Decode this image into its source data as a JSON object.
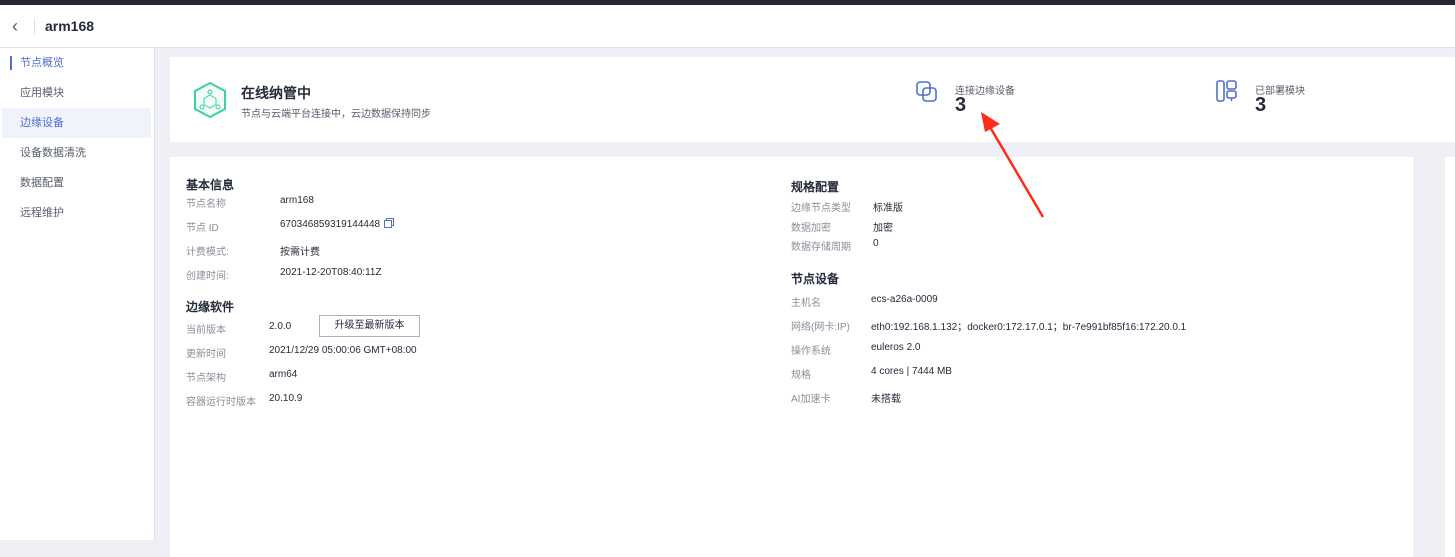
{
  "header": {
    "title": "arm168",
    "back_icon": "chevron-left-icon"
  },
  "sidebar": {
    "items": [
      {
        "label": "节点概览",
        "selected": true
      },
      {
        "label": "应用模块"
      },
      {
        "label": "边缘设备",
        "highlighted": true
      },
      {
        "label": "设备数据清洗"
      },
      {
        "label": "数据配置"
      },
      {
        "label": "远程维护"
      }
    ]
  },
  "status": {
    "title": "在线纳管中",
    "subtitle": "节点与云端平台连接中，云边数据保持同步",
    "stats": [
      {
        "label": "连接边缘设备",
        "value": "3",
        "icon": "linked-squares-icon"
      },
      {
        "label": "已部署模块",
        "value": "3",
        "icon": "module-layout-icon"
      }
    ]
  },
  "basic": {
    "title": "基本信息",
    "rows": [
      {
        "k": "节点名称",
        "v": "arm168"
      },
      {
        "k": "节点 ID",
        "v": "670346859319144448"
      },
      {
        "k": "计费模式:",
        "v": "按需计费"
      },
      {
        "k": "创建时间:",
        "v": "2021-12-20T08:40:11Z"
      }
    ]
  },
  "software": {
    "title": "边缘软件",
    "rows": [
      {
        "k": "当前版本",
        "v": "2.0.0"
      },
      {
        "k": "更新时间",
        "v": "2021/12/29 05:00:06 GMT+08:00"
      },
      {
        "k": "节点架构",
        "v": "arm64"
      },
      {
        "k": "容器运行时版本",
        "v": "20.10.9"
      }
    ],
    "upgrade_label": "升级至最新版本"
  },
  "spec": {
    "title": "规格配置",
    "rows": [
      {
        "k": "边缘节点类型",
        "v": "标准版"
      },
      {
        "k": "数据加密",
        "v": "加密"
      },
      {
        "k": "数据存储周期",
        "v": "0"
      }
    ]
  },
  "device": {
    "title": "节点设备",
    "rows": [
      {
        "k": "主机名",
        "v": "ecs-a26a-0009"
      },
      {
        "k": "网络(网卡:IP)",
        "v": "eth0:192.168.1.132；docker0:172.17.0.1；br-7e991bf85f16:172.20.0.1"
      },
      {
        "k": "操作系统",
        "v": "euleros 2.0"
      },
      {
        "k": "规格",
        "v": "4 cores | 7444 MB"
      },
      {
        "k": "AI加速卡",
        "v": "未搭载"
      }
    ]
  },
  "colors": {
    "accent": "#526ecc",
    "status_green": "#3fcfa0",
    "annotation_arrow": "#ff2a1a"
  }
}
